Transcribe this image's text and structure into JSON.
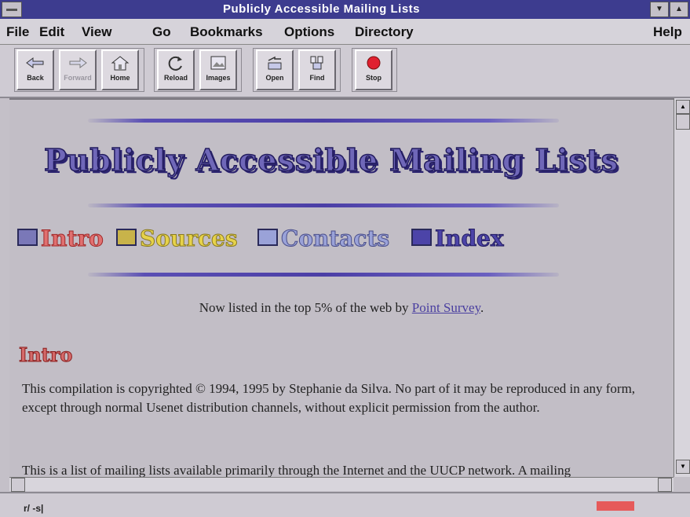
{
  "window": {
    "title": "Publicly Accessible Mailing Lists",
    "minimize_glyph": "▼",
    "maximize_glyph": "▲"
  },
  "menu": [
    {
      "label": "File",
      "accel": "F"
    },
    {
      "label": "Edit",
      "accel": "E"
    },
    {
      "label": "View",
      "accel": "V"
    },
    {
      "label": "Go",
      "accel": "G"
    },
    {
      "label": "Bookmarks",
      "accel": "B"
    },
    {
      "label": "Options",
      "accel": "O"
    },
    {
      "label": "Directory",
      "accel": "D"
    },
    {
      "label": "Help",
      "accel": "H"
    }
  ],
  "toolbar": {
    "back": {
      "label": "Back",
      "icon": "back-arrow-icon"
    },
    "forward": {
      "label": "Forward",
      "icon": "forward-arrow-icon",
      "disabled": true
    },
    "home": {
      "label": "Home",
      "icon": "house-icon"
    },
    "reload": {
      "label": "Reload",
      "icon": "reload-icon"
    },
    "images": {
      "label": "Images",
      "icon": "images-icon"
    },
    "open": {
      "label": "Open",
      "icon": "open-icon"
    },
    "find": {
      "label": "Find",
      "icon": "find-icon"
    },
    "stop": {
      "label": "Stop",
      "icon": "stop-icon"
    }
  },
  "page": {
    "heading": "Publicly Accessible Mailing Lists",
    "nav": [
      {
        "label": "Intro",
        "color": "#e07070"
      },
      {
        "label": "Sources",
        "color": "#e6d24a"
      },
      {
        "label": "Contacts",
        "color": "#9aa2d8"
      },
      {
        "label": "Index",
        "color": "#4c44a8"
      }
    ],
    "listed_prefix": "Now listed in the top 5% of the web by ",
    "listed_link": "Point Survey",
    "listed_suffix": ".",
    "intro_heading": "Intro",
    "para1": "This compilation is copyrighted © 1994, 1995 by Stephanie da Silva. No part of it may be reproduced in any form, except through normal Usenet distribution channels, without explicit permission from the author.",
    "para2": "This is a list of mailing lists available primarily through the Internet and the UUCP network. A mailing"
  },
  "status": {
    "icon_text": "r/ -s|"
  },
  "colors": {
    "titlebar": "#3d3c8f",
    "heading": "#6f67b8",
    "link": "#4a3fa0",
    "progress": "#e65a5a"
  }
}
